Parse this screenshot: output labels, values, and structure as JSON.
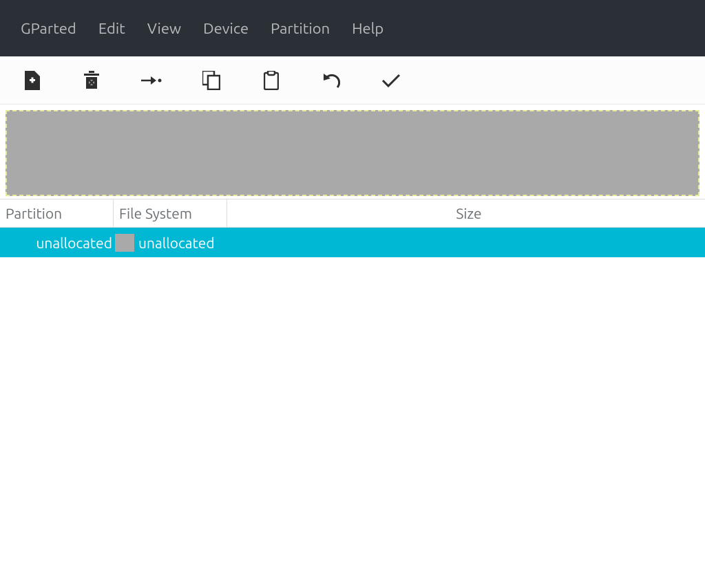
{
  "menubar": [
    "GParted",
    "Edit",
    "View",
    "Device",
    "Partition",
    "Help"
  ],
  "toolbar": {
    "new": "new-partition",
    "delete": "delete-partition",
    "resize": "resize-move",
    "copy": "copy-partition",
    "paste": "paste-partition",
    "undo": "undo",
    "apply": "apply"
  },
  "columns": {
    "partition": "Partition",
    "filesystem": "File System",
    "size": "Size"
  },
  "rows": [
    {
      "partition": "unallocated",
      "filesystem": "unallocated",
      "size": ""
    }
  ]
}
